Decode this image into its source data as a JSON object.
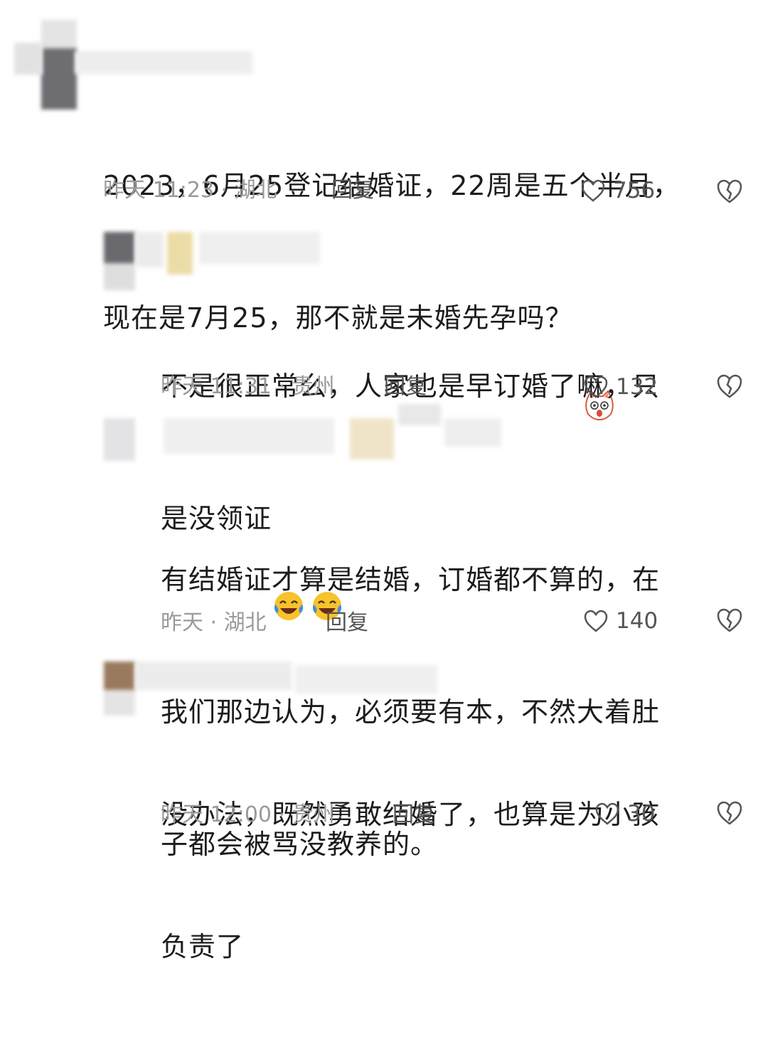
{
  "comments": [
    {
      "text_lines": [
        "2023，6月25登记结婚证，22周是五个半月，",
        "现在是7月25，那不就是未婚先孕吗？"
      ],
      "emoji": [
        "cat-shocked-emoji"
      ],
      "time_location": "昨天 11:23 · 湖北",
      "reply_label": "回复",
      "likes": "756"
    },
    {
      "text_lines": [
        "不是很正常么，人家也是早订婚了嘛，只",
        "是没领证"
      ],
      "emoji": [
        "laugh-cry-emoji",
        "laugh-cry-emoji"
      ],
      "time_location": "昨天 11:31 · 贵州",
      "reply_label": "回复",
      "likes": "132"
    },
    {
      "text_lines": [
        "有结婚证才算是结婚，订婚都不算的，在",
        "我们那边认为，必须要有本，不然大着肚",
        "子都会被骂没教养的。"
      ],
      "emoji": [],
      "time_location": "昨天 · 湖北",
      "reply_label": "回复",
      "likes": "140"
    },
    {
      "text_lines": [
        "没办法，既然勇敢结婚了，也算是为小孩",
        "负责了"
      ],
      "emoji": [],
      "time_location": "昨天 12:00 · 贵州",
      "reply_label": "回复",
      "likes": "30"
    }
  ],
  "icons": {
    "like": "heart-outline-icon",
    "dislike": "broken-heart-icon"
  },
  "colors": {
    "text": "#1c1c1c",
    "meta": "#9a9a9a",
    "icon": "#555555"
  }
}
